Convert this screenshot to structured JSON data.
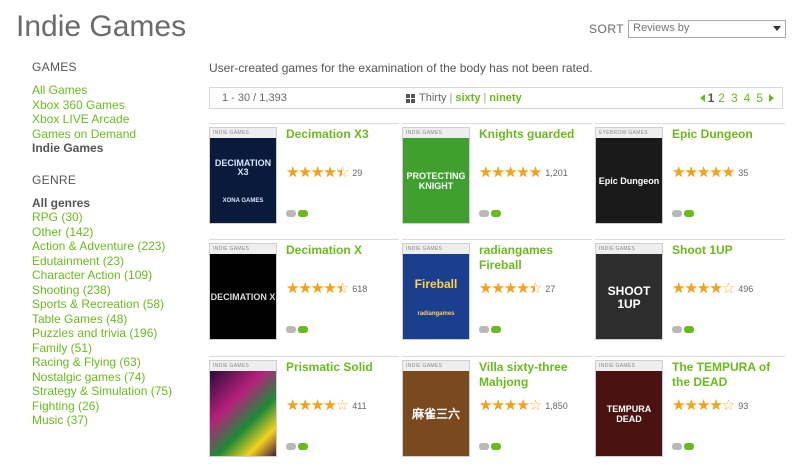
{
  "page_title": "Indie Games",
  "sort": {
    "label": "SORT",
    "value": "Reviews by"
  },
  "sidebar": {
    "games_heading": "GAMES",
    "games": [
      {
        "label": "All Games",
        "active": false
      },
      {
        "label": "Xbox 360 Games",
        "active": false
      },
      {
        "label": "Xbox LIVE Arcade",
        "active": false
      },
      {
        "label": "Games on Demand",
        "active": false
      },
      {
        "label": "Indie Games",
        "active": true
      }
    ],
    "genre_heading": "GENRE",
    "genres": [
      {
        "label": "All genres",
        "active": true
      },
      {
        "label": "RPG (30)",
        "active": false
      },
      {
        "label": "Other (142)",
        "active": false
      },
      {
        "label": "Action & Adventure (223)",
        "active": false
      },
      {
        "label": "Edutainment (23)",
        "active": false
      },
      {
        "label": "Character Action (109)",
        "active": false
      },
      {
        "label": "Shooting (238)",
        "active": false
      },
      {
        "label": "Sports & Recreation (58)",
        "active": false
      },
      {
        "label": "Table Games (48)",
        "active": false
      },
      {
        "label": "Puzzles and trivia (196)",
        "active": false
      },
      {
        "label": "Family (51)",
        "active": false
      },
      {
        "label": "Racing & Flying (63)",
        "active": false
      },
      {
        "label": "Nostalgic games (74)",
        "active": false
      },
      {
        "label": "Strategy & Simulation (75)",
        "active": false
      },
      {
        "label": "Fighting (26)",
        "active": false
      },
      {
        "label": "Music (37)",
        "active": false
      }
    ]
  },
  "description": "User-created games for the examination of the body has not been rated.",
  "pager": {
    "range": "1 - 30 / 1,393",
    "per_page": {
      "current": "Thirty",
      "sep": "|",
      "options": [
        "sixty",
        "ninety"
      ]
    },
    "pages": [
      "1",
      "2",
      "3",
      "4",
      "5"
    ],
    "current_page": "1"
  },
  "colors": {
    "accent": "#6bba1c",
    "star": "#f2a31b",
    "text": "#555555"
  },
  "tile_band_label": "INDIE GAMES",
  "games": [
    {
      "title": "Decimation X3",
      "rating": 4.5,
      "count": "29",
      "art_text": "DECIMATION X3",
      "art_footer": "XONA GAMES",
      "art_bg": "#0a1a3a",
      "art_fg": "#cfe8ff",
      "band": "INDIE GAMES"
    },
    {
      "title": "Knights guarded",
      "rating": 5,
      "count": "1,201",
      "art_text": "PROTECTING KNIGHT",
      "art_footer": "",
      "art_bg": "#3f9f2f",
      "art_fg": "#ffffff",
      "band": "INDIE GAMES"
    },
    {
      "title": "Epic Dungeon",
      "rating": 5,
      "count": "35",
      "art_text": "Epic Dungeon",
      "art_footer": "",
      "art_bg": "#1a1a1a",
      "art_fg": "#ffffff",
      "band": "EYEBROW GAMES"
    },
    {
      "title": "Decimation X",
      "rating": 4.5,
      "count": "618",
      "art_text": "DECIMATION X",
      "art_footer": "",
      "art_bg": "#000000",
      "art_fg": "#dddddd",
      "band": "INDIE GAMES"
    },
    {
      "title": "radiangames Fireball",
      "rating": 4.5,
      "count": "27",
      "art_text": "Fireball",
      "art_footer": "radiangames",
      "art_bg": "#1b3f8f",
      "art_fg": "#ffd24a",
      "band": "INDIE GAMES"
    },
    {
      "title": "Shoot 1UP",
      "rating": 4,
      "count": "496",
      "art_text": "SHOOT 1UP",
      "art_footer": "",
      "art_bg": "#2d2d2d",
      "art_fg": "#ffffff",
      "band": "INDIE GAMES"
    },
    {
      "title": "Prismatic Solid",
      "rating": 4,
      "count": "411",
      "art_text": "",
      "art_footer": "",
      "art_bg": "#3a0d3f",
      "art_fg": "#ffffff",
      "band": "INDIE GAMES"
    },
    {
      "title": "Villa sixty-three Mahjong",
      "rating": 4,
      "count": "1,850",
      "art_text": "麻雀三六",
      "art_footer": "",
      "art_bg": "#7a4a1e",
      "art_fg": "#ffffff",
      "band": "INDIE GAMES"
    },
    {
      "title": "The TEMPURA of the DEAD",
      "rating": 4,
      "count": "93",
      "art_text": "TEMPURA DEAD",
      "art_footer": "",
      "art_bg": "#4a1210",
      "art_fg": "#ffffff",
      "band": "INDIE GAMES"
    }
  ]
}
